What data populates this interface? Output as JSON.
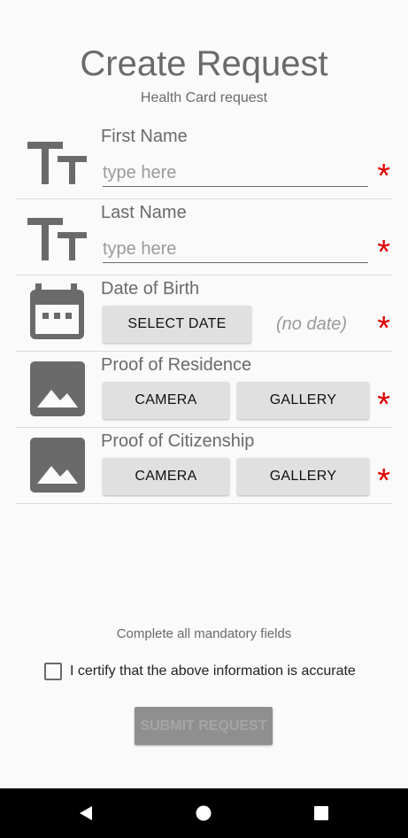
{
  "header": {
    "title": "Create Request",
    "subtitle": "Health Card request"
  },
  "fields": {
    "first_name": {
      "label": "First Name",
      "placeholder": "type here",
      "icon": "text-fields-icon",
      "required_mark": "*"
    },
    "last_name": {
      "label": "Last Name",
      "placeholder": "type here",
      "icon": "text-fields-icon",
      "required_mark": "*"
    },
    "dob": {
      "label": "Date of Birth",
      "button": "SELECT DATE",
      "value": "(no date)",
      "icon": "calendar-icon",
      "required_mark": "*"
    },
    "residence": {
      "label": "Proof of Residence",
      "camera": "CAMERA",
      "gallery": "GALLERY",
      "icon": "image-icon",
      "required_mark": "*"
    },
    "citizenship": {
      "label": "Proof of Citizenship",
      "camera": "CAMERA",
      "gallery": "GALLERY",
      "icon": "image-icon",
      "required_mark": "*"
    }
  },
  "footer": {
    "hint": "Complete all mandatory fields",
    "certify": "I certify that the above information is accurate",
    "certify_checked": false,
    "submit": "SUBMIT REQUEST",
    "submit_enabled": false
  },
  "navbar": {
    "back": "back-icon",
    "home": "home-icon",
    "recents": "recents-icon"
  },
  "colors": {
    "background": "#fafafa",
    "text": "#6a6a6a",
    "required": "#e00000",
    "button": "#e0e0e0",
    "submit_disabled": "#8f8f8f",
    "navbar": "#000000"
  }
}
